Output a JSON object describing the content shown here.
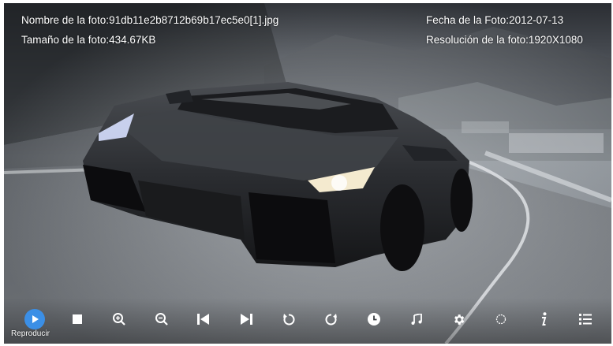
{
  "photo_info": {
    "name_label": "Nombre de la foto:",
    "name_value": "91db11e2b8712b69b17ec5e0[1].jpg",
    "size_label": "Tamaño de la foto:",
    "size_value": "434.67KB",
    "date_label": "Fecha de la Foto:",
    "date_value": "2012-07-13",
    "resolution_label": "Resolución de la foto:",
    "resolution_value": "1920X1080"
  },
  "toolbar": {
    "play_label": "Reproducir",
    "buttons": [
      "play-icon",
      "stop-icon",
      "zoom-in-icon",
      "zoom-out-icon",
      "previous-icon",
      "next-icon",
      "rotate-left-icon",
      "rotate-right-icon",
      "clock-icon",
      "music-icon",
      "settings-icon",
      "loading-icon",
      "info-icon",
      "list-icon"
    ],
    "accent_color": "#3b8fe6"
  }
}
